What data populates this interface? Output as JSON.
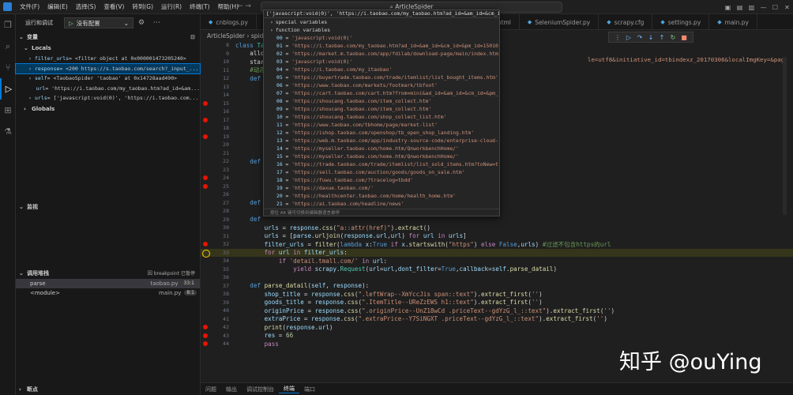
{
  "titlebar": {
    "menu": [
      "文件(F)",
      "编辑(E)",
      "选择(S)",
      "查看(V)",
      "转到(G)",
      "运行(R)",
      "终端(T)",
      "帮助(H)"
    ],
    "search": "ArticleSpider"
  },
  "sidebar": {
    "header": "运行和调试",
    "config": "没有配置",
    "variables_section": "变量",
    "locals": "Locals",
    "globals": "Globals",
    "vars": [
      {
        "name": "filter_urls",
        "value": " = <filter object at 0x000001473205240>"
      },
      {
        "name": "response",
        "value": " = <200 https://s.taobao.com/search?_input_..."
      },
      {
        "name": "self",
        "value": " = <TaobaoSpider 'taobao' at 0x14728aad490>"
      },
      {
        "name": "url",
        "value": " = 'https://i.taobao.com/my_taobao.htm?ad_id=&am..."
      },
      {
        "name": "urls",
        "value": " = ['javascript:void(0)', 'https://i.taobao.com..."
      }
    ],
    "watch_section": "监视",
    "callstack_section": "调用堆栈",
    "callstack_badge": "因 breakpoint 已暂停",
    "frames": [
      {
        "name": "parse",
        "file": "taobao.py",
        "line": "33:1"
      },
      {
        "name": "<module>",
        "file": "main.py",
        "line": "8:1"
      }
    ],
    "breakpoints_section": "断点"
  },
  "editor": {
    "tabs": [
      "cnblogs.py",
      "html.html",
      "SeleniumSpider.py",
      "scrapy.cfg",
      "settings.py",
      "main.py"
    ],
    "breadcrumb": "ArticleSpider › spid",
    "lines": [
      {
        "n": "8",
        "bp": "",
        "html": "<span class=\"k\">class</span> <span class=\"t\">Ta</span>"
      },
      {
        "n": "9",
        "bp": "",
        "html": "    allo"
      },
      {
        "n": "10",
        "bp": "",
        "html": "    star"
      },
      {
        "n": "11",
        "bp": "",
        "html": "    <span class=\"c\">#动态</span>"
      },
      {
        "n": "12",
        "bp": "",
        "html": "    <span class=\"k\">def</span>"
      },
      {
        "n": "13",
        "bp": "",
        "html": ""
      },
      {
        "n": "14",
        "bp": "",
        "html": ""
      },
      {
        "n": "15",
        "bp": "on",
        "html": ""
      },
      {
        "n": "16",
        "bp": "",
        "html": ""
      },
      {
        "n": "17",
        "bp": "on",
        "html": ""
      },
      {
        "n": "18",
        "bp": "",
        "html": ""
      },
      {
        "n": "19",
        "bp": "on",
        "html": ""
      },
      {
        "n": "20",
        "bp": "",
        "html": ""
      },
      {
        "n": "21",
        "bp": "",
        "html": ""
      },
      {
        "n": "22",
        "bp": "",
        "html": "    <span class=\"k\">def</span>"
      },
      {
        "n": "23",
        "bp": "",
        "html": ""
      },
      {
        "n": "24",
        "bp": "on",
        "html": ""
      },
      {
        "n": "25",
        "bp": "on",
        "html": ""
      },
      {
        "n": "26",
        "bp": "",
        "html": ""
      },
      {
        "n": "27",
        "bp": "",
        "html": "    <span class=\"k\">def</span>"
      },
      {
        "n": "28",
        "bp": "",
        "html": ""
      },
      {
        "n": "29",
        "bp": "",
        "html": "    <span class=\"k\">def</span>"
      },
      {
        "n": "30",
        "bp": "",
        "html": "        <span class=\"v\">urls</span> = <span class=\"v\">response</span>.<span class=\"f\">css</span>(<span class=\"s\">\"a::attr(href)\"</span>).<span class=\"f\">extract</span>()"
      },
      {
        "n": "31",
        "bp": "",
        "html": "        <span class=\"v\">urls</span> = [<span class=\"v\">parse</span>.<span class=\"f\">urljoin</span>(<span class=\"v\">response</span>.<span class=\"v\">url</span>,<span class=\"v\">url</span>) <span class=\"kw\">for</span> <span class=\"v\">url</span> <span class=\"kw\">in</span> <span class=\"v\">urls</span>]"
      },
      {
        "n": "32",
        "bp": "on",
        "html": "        <span class=\"v\">filter_urls</span> = <span class=\"f\">filter</span>(<span class=\"k\">lambda</span> <span class=\"v\">x</span>:<span class=\"k\">True</span> <span class=\"kw\">if</span> <span class=\"v\">x</span>.<span class=\"f\">startswith</span>(<span class=\"s\">\"https\"</span>) <span class=\"kw\">else</span> <span class=\"k\">False</span>,<span class=\"v\">urls</span>) <span class=\"c\">#过滤不包含https的url</span>"
      },
      {
        "n": "33",
        "bp": "cur",
        "html": "        <span class=\"kw\">for</span> <span class=\"v\">url</span> <span class=\"kw\">in</span> <span class=\"v\">filter_urls</span>:"
      },
      {
        "n": "34",
        "bp": "",
        "html": "            <span class=\"kw\">if</span> <span class=\"s\">'detail.tmall.com/'</span> <span class=\"kw\">in</span> <span class=\"v\">url</span>:"
      },
      {
        "n": "35",
        "bp": "",
        "html": "                <span class=\"kw\">yield</span> <span class=\"v\">scrapy</span>.<span class=\"t\">Request</span>(<span class=\"v\">url</span>=<span class=\"v\">url</span>,<span class=\"v\">dont_filter</span>=<span class=\"k\">True</span>,<span class=\"v\">callback</span>=<span class=\"v\">self</span>.<span class=\"f\">parse_datail</span>)"
      },
      {
        "n": "36",
        "bp": "",
        "html": ""
      },
      {
        "n": "37",
        "bp": "",
        "html": "    <span class=\"k\">def</span> <span class=\"f\">parse_datail</span>(<span class=\"v\">self</span>, <span class=\"v\">response</span>):"
      },
      {
        "n": "38",
        "bp": "",
        "html": "        <span class=\"v\">shop_title</span> = <span class=\"v\">response</span>.<span class=\"f\">css</span>(<span class=\"s\">\".leftWrap--XmYccJis span::text\"</span>).<span class=\"f\">extract_first</span>(<span class=\"s\">''</span>)"
      },
      {
        "n": "39",
        "bp": "",
        "html": "        <span class=\"v\">goods_title</span> = <span class=\"v\">response</span>.<span class=\"f\">css</span>(<span class=\"s\">\".ItemTitle--UReZzEWS h1::text\"</span>).<span class=\"f\">extract_first</span>(<span class=\"s\">''</span>)"
      },
      {
        "n": "40",
        "bp": "",
        "html": "        <span class=\"v\">originPrice</span> = <span class=\"v\">response</span>.<span class=\"f\">css</span>(<span class=\"s\">\".originPrice--UnZ18wCd .priceText--gdYzG_l_::text\"</span>).<span class=\"f\">extract_first</span>(<span class=\"s\">''</span>)"
      },
      {
        "n": "41",
        "bp": "",
        "html": "        <span class=\"v\">extraPrice</span> = <span class=\"v\">response</span>.<span class=\"f\">css</span>(<span class=\"s\">\".extraPrice--Y7SiNGXT .priceText--gdYzG_l_::text\"</span>).<span class=\"f\">extract_first</span>(<span class=\"s\">''</span>)"
      },
      {
        "n": "42",
        "bp": "on",
        "html": "        <span class=\"f\">print</span>(<span class=\"v\">response</span>.<span class=\"v\">url</span>)"
      },
      {
        "n": "43",
        "bp": "on",
        "html": "        <span class=\"v\">res</span> = <span class=\"n\">66</span>"
      },
      {
        "n": "44",
        "bp": "on",
        "html": "        <span class=\"kw\">pass</span>"
      }
    ],
    "overflow_text": "le=utf8&initiative_id=tbindexz_20170306&localImgKey=&page=1&q=%E5%88%98%E6%84%8F%E5"
  },
  "hover": {
    "header": "['javascript:void(0)', 'https://i.taobao.com/my_taobao.htm?ad_id=&am_id=&cm_id=&pm_id=1...",
    "special": "special variables",
    "function": "function variables",
    "items": [
      "00 = 'javascript:void(0)'",
      "01 = 'https://i.taobao.com/my_taobao.htm?ad_id=&am_id=&cm_id=&pm_id=15010",
      "02 = 'https://market.m.taobao.com/app/fdilab/download-page/main/index.htm",
      "03 = 'javascript:void(0)'",
      "04 = 'https://i.taobao.com/my_itaobao'",
      "05 = 'https://buyertrade.taobao.com/trade/itemlist/list_bought_items.htm'",
      "06 = 'https://www.taobao.com/markets/footmark/tbfoot'",
      "07 = 'https://cart.taobao.com/cart.htm?from=mini&ad_id=&am_id=&cm_id=&pm_",
      "08 = 'https://shoucang.taobao.com/item_collect.htm'",
      "09 = 'https://shoucang.taobao.com/item_collect.htm'",
      "10 = 'https://shoucang.taobao.com/shop_collect_list.htm'",
      "11 = 'https://www.taobao.com/tbhome/page/market-list'",
      "12 = 'https://ishop.taobao.com/openshop/tb_open_shop_landing.htm'",
      "13 = 'https://web.m.taobao.com/app/industry-source-code/enterprise-cloud-",
      "14 = 'https://myseller.taobao.com/home.htm/QnworkbenchHome/'",
      "15 = 'https://myseller.taobao.com/home.htm/QnworkbenchHome/'",
      "16 = 'https://trade.taobao.com/trade/itemlist/list_sold_items.htm?toNew=t",
      "17 = 'https://sell.taobao.com/auction/goods/goods_on_sale.htm'",
      "18 = 'https://fuwu.taobao.com/?tracelog=tbdd'",
      "19 = 'https://daxue.taobao.com/'",
      "20 = 'https://healthcenter.taobao.com/home/health_home.htm'",
      "21 = 'https://ai.taobao.com/headline/news'"
    ],
    "footer": "按住 Alt 键可切换到编辑器语言悬停"
  },
  "panel": {
    "tabs": [
      "问题",
      "输出",
      "调试控制台",
      "终端",
      "端口"
    ],
    "active": "终端"
  },
  "watermark": "知乎 @ouYing"
}
